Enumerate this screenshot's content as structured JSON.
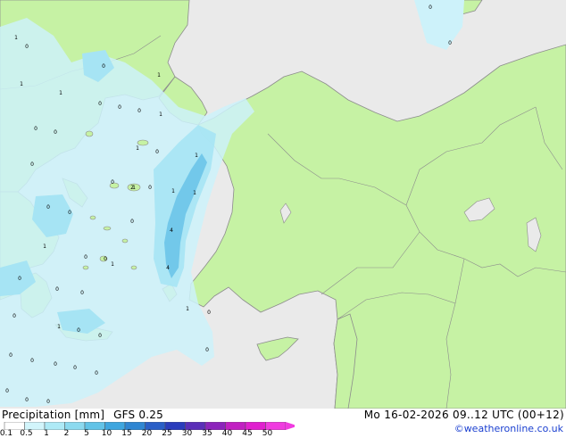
{
  "header": {
    "product_label": "Precipitation [mm]",
    "model_label": "GFS 0.25",
    "datetime_label": "Mo 16-02-2026 09..12 UTC (00+12)",
    "credit": "©weatheronline.co.uk"
  },
  "legend": {
    "ticks": [
      "0.1",
      "0.5",
      "1",
      "2",
      "5",
      "10",
      "15",
      "20",
      "25",
      "30",
      "35",
      "40",
      "45",
      "50"
    ],
    "colors": [
      "#ffffff",
      "#d2f5fb",
      "#aeeaf6",
      "#8cdaef",
      "#62c3e7",
      "#3ea6df",
      "#2f86d2",
      "#2a5fc7",
      "#2b3dbc",
      "#5b2fb8",
      "#8c24bb",
      "#c120c2",
      "#e020cf",
      "#f03ce0"
    ]
  },
  "colors": {
    "sea": "#eaeaea",
    "land": "#c6f2a4",
    "border": "#8c8c8c",
    "precip_light": "#cdf2fa",
    "precip_mid": "#a6e4f4",
    "precip_heavy": "#72c8ea"
  },
  "map": {
    "region": "Aegean Sea and Turkey",
    "value_labels": [
      "0",
      "1",
      "0",
      "1",
      "0",
      "0",
      "1",
      "0",
      "0",
      "0",
      "1",
      "1",
      "0",
      "1",
      "0",
      "1",
      "0",
      "0",
      "0",
      "1",
      "2",
      "0",
      "1",
      "0",
      "0",
      "1",
      "0",
      "4",
      "1",
      "4",
      "0",
      "0",
      "1",
      "0",
      "0",
      "0",
      "0",
      "1",
      "0",
      "0",
      "0",
      "1",
      "0",
      "0",
      "0",
      "0",
      "0",
      "0",
      "0",
      "0",
      "0"
    ]
  }
}
